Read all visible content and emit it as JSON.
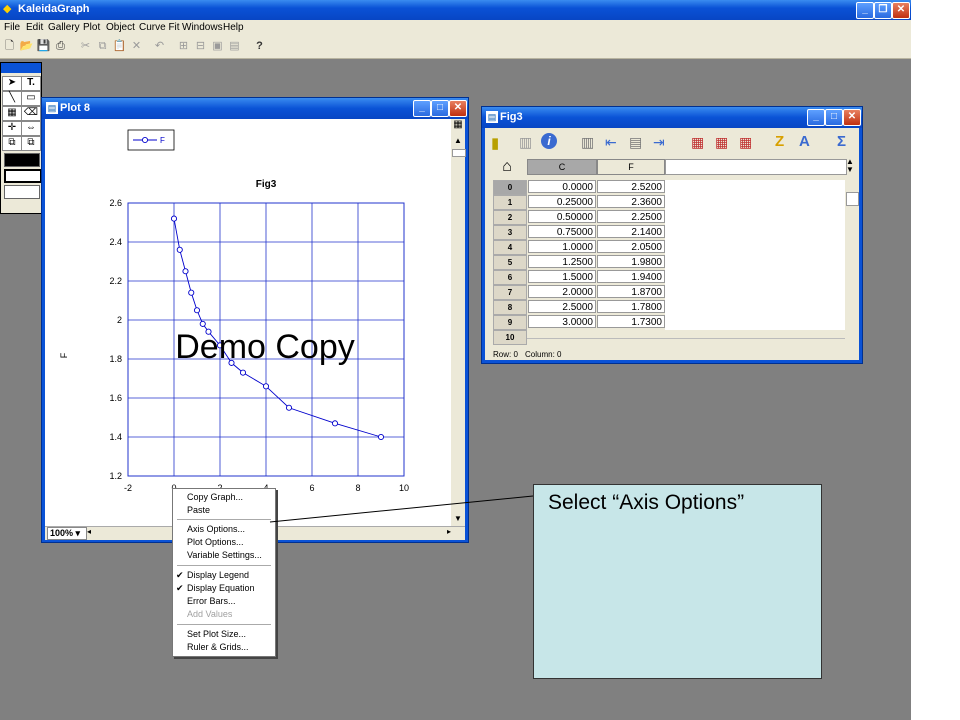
{
  "app": {
    "title": "KaleidaGraph"
  },
  "menubar": [
    "File",
    "Edit",
    "Gallery",
    "Plot",
    "Object",
    "Curve Fit",
    "Windows",
    "Help"
  ],
  "toolbar": {
    "help": "?"
  },
  "palette": {
    "text_tool": "T."
  },
  "plot_window": {
    "title": "Plot 8",
    "zoom": "100%",
    "legend": "F",
    "chart_title": "Fig3",
    "ylabel": "F",
    "watermark": "Demo Copy"
  },
  "chart_data": {
    "type": "line",
    "title": "Fig3",
    "xlabel": "",
    "ylabel": "F",
    "xlim": [
      -2,
      10
    ],
    "ylim": [
      1.2,
      2.6
    ],
    "grid": true,
    "legend_position": "top-left",
    "x_ticks": [
      "-2",
      "0",
      "2",
      "4",
      "6",
      "8",
      "10"
    ],
    "y_ticks": [
      "1.2",
      "1.4",
      "1.6",
      "1.8",
      "2",
      "2.2",
      "2.4",
      "2.6"
    ],
    "series": [
      {
        "name": "F",
        "x": [
          0,
          0.25,
          0.5,
          0.75,
          1.0,
          1.25,
          1.5,
          2.0,
          2.5,
          3.0,
          4.0,
          5.0,
          7.0,
          9.0
        ],
        "y": [
          2.52,
          2.36,
          2.25,
          2.14,
          2.05,
          1.98,
          1.94,
          1.87,
          1.78,
          1.73,
          1.66,
          1.55,
          1.47,
          1.4
        ]
      }
    ],
    "colors": {
      "line": "#0000cc",
      "grid": "#2233cc"
    }
  },
  "data_window": {
    "title": "Fig3",
    "columns": [
      "C",
      "F"
    ],
    "rows": [
      {
        "i": "0",
        "c": "0.0000",
        "f": "2.5200"
      },
      {
        "i": "1",
        "c": "0.25000",
        "f": "2.3600"
      },
      {
        "i": "2",
        "c": "0.50000",
        "f": "2.2500"
      },
      {
        "i": "3",
        "c": "0.75000",
        "f": "2.1400"
      },
      {
        "i": "4",
        "c": "1.0000",
        "f": "2.0500"
      },
      {
        "i": "5",
        "c": "1.2500",
        "f": "1.9800"
      },
      {
        "i": "6",
        "c": "1.5000",
        "f": "1.9400"
      },
      {
        "i": "7",
        "c": "2.0000",
        "f": "1.8700"
      },
      {
        "i": "8",
        "c": "2.5000",
        "f": "1.7800"
      },
      {
        "i": "9",
        "c": "3.0000",
        "f": "1.7300"
      }
    ],
    "next_row": "10",
    "status_row": "Row: 0",
    "status_column": "Column: 0"
  },
  "context_menu": {
    "items": [
      {
        "label": "Copy Graph...",
        "disabled": false,
        "checked": false
      },
      {
        "label": "Paste",
        "disabled": false,
        "checked": false
      },
      {
        "label": "Axis Options...",
        "disabled": false,
        "checked": false
      },
      {
        "label": "Plot Options...",
        "disabled": false,
        "checked": false
      },
      {
        "label": "Variable Settings...",
        "disabled": false,
        "checked": false
      },
      {
        "label": "Display Legend",
        "disabled": false,
        "checked": true
      },
      {
        "label": "Display Equation",
        "disabled": false,
        "checked": true
      },
      {
        "label": "Error Bars...",
        "disabled": false,
        "checked": false
      },
      {
        "label": "Add Values",
        "disabled": true,
        "checked": false
      },
      {
        "label": "Set Plot Size...",
        "disabled": false,
        "checked": false
      },
      {
        "label": "Ruler & Grids...",
        "disabled": false,
        "checked": false
      }
    ]
  },
  "callout": {
    "text": "Select “Axis Options”"
  }
}
